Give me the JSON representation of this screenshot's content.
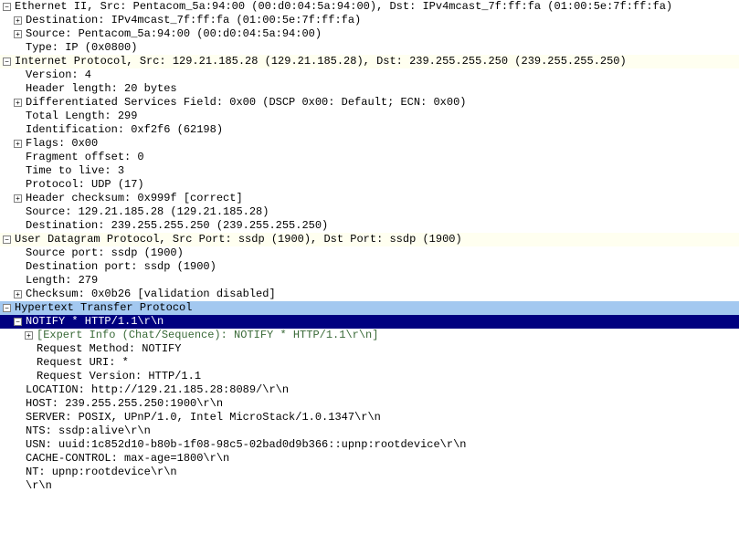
{
  "eth": {
    "header": "Ethernet II, Src: Pentacom_5a:94:00 (00:d0:04:5a:94:00), Dst: IPv4mcast_7f:ff:fa (01:00:5e:7f:ff:fa)",
    "dst": "Destination: IPv4mcast_7f:ff:fa (01:00:5e:7f:ff:fa)",
    "src": "Source: Pentacom_5a:94:00 (00:d0:04:5a:94:00)",
    "type": "Type: IP (0x0800)"
  },
  "ip": {
    "header": "Internet Protocol, Src: 129.21.185.28 (129.21.185.28), Dst: 239.255.255.250 (239.255.255.250)",
    "version": "Version: 4",
    "hlen": "Header length: 20 bytes",
    "dsf": "Differentiated Services Field: 0x00 (DSCP 0x00: Default; ECN: 0x00)",
    "tlen": "Total Length: 299",
    "ident": "Identification: 0xf2f6 (62198)",
    "flags": "Flags: 0x00",
    "frag": "Fragment offset: 0",
    "ttl": "Time to live: 3",
    "proto": "Protocol: UDP (17)",
    "chksum": "Header checksum: 0x999f [correct]",
    "src": "Source: 129.21.185.28 (129.21.185.28)",
    "dst": "Destination: 239.255.255.250 (239.255.255.250)"
  },
  "udp": {
    "header": "User Datagram Protocol, Src Port: ssdp (1900), Dst Port: ssdp (1900)",
    "srcport": "Source port: ssdp (1900)",
    "dstport": "Destination port: ssdp (1900)",
    "len": "Length: 279",
    "chksum": "Checksum: 0x0b26 [validation disabled]"
  },
  "http": {
    "header": "Hypertext Transfer Protocol",
    "request": "NOTIFY * HTTP/1.1\\r\\n",
    "expert": "[Expert Info (Chat/Sequence): NOTIFY * HTTP/1.1\\r\\n]",
    "method": "Request Method: NOTIFY",
    "uri": "Request URI: *",
    "version": "Request Version: HTTP/1.1",
    "location": "LOCATION: http://129.21.185.28:8089/\\r\\n",
    "host": "HOST: 239.255.255.250:1900\\r\\n",
    "server": "SERVER: POSIX, UPnP/1.0, Intel MicroStack/1.0.1347\\r\\n",
    "nts": "NTS: ssdp:alive\\r\\n",
    "usn": "USN: uuid:1c852d10-b80b-1f08-98c5-02bad0d9b366::upnp:rootdevice\\r\\n",
    "cache": "CACHE-CONTROL: max-age=1800\\r\\n",
    "nt": "NT: upnp:rootdevice\\r\\n",
    "crlf": "\\r\\n"
  }
}
